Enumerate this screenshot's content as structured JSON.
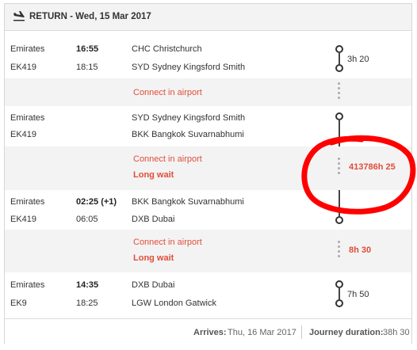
{
  "header": {
    "title": "RETURN - Wed, 15 Mar 2017"
  },
  "segments": [
    {
      "airline": "Emirates",
      "flight": "EK419",
      "dep_time": "16:55",
      "arr_time": "18:15",
      "dep_airport": "CHC Christchurch",
      "arr_airport": "SYD Sydney Kingsford Smith",
      "duration": "3h 20"
    },
    {
      "airline": "Emirates",
      "flight": "EK419",
      "dep_time": "",
      "arr_time": "",
      "dep_airport": "SYD Sydney Kingsford Smith",
      "arr_airport": "BKK Bangkok Suvarnabhumi",
      "duration": ""
    },
    {
      "airline": "Emirates",
      "flight": "EK419",
      "dep_time": "02:25 (+1)",
      "arr_time": "06:05",
      "dep_airport": "BKK Bangkok Suvarnabhumi",
      "arr_airport": "DXB Dubai",
      "duration": ""
    },
    {
      "airline": "Emirates",
      "flight": "EK9",
      "dep_time": "14:35",
      "arr_time": "18:25",
      "dep_airport": "DXB Dubai",
      "arr_airport": "LGW London Gatwick",
      "duration": "7h 50"
    }
  ],
  "connections": [
    {
      "label": "Connect in airport",
      "warning": "",
      "wait": ""
    },
    {
      "label": "Connect in airport",
      "warning": "Long wait",
      "wait": "413786h 25"
    },
    {
      "label": "Connect in airport",
      "warning": "Long wait",
      "wait": "8h 30"
    }
  ],
  "footer": {
    "arrives_label": "Arrives:",
    "arrives_value": "Thu, 16 Mar 2017",
    "duration_label": "Journey duration:",
    "duration_value": "38h 30"
  },
  "colors": {
    "warning": "#e04e39",
    "annotation": "#ff0000"
  }
}
